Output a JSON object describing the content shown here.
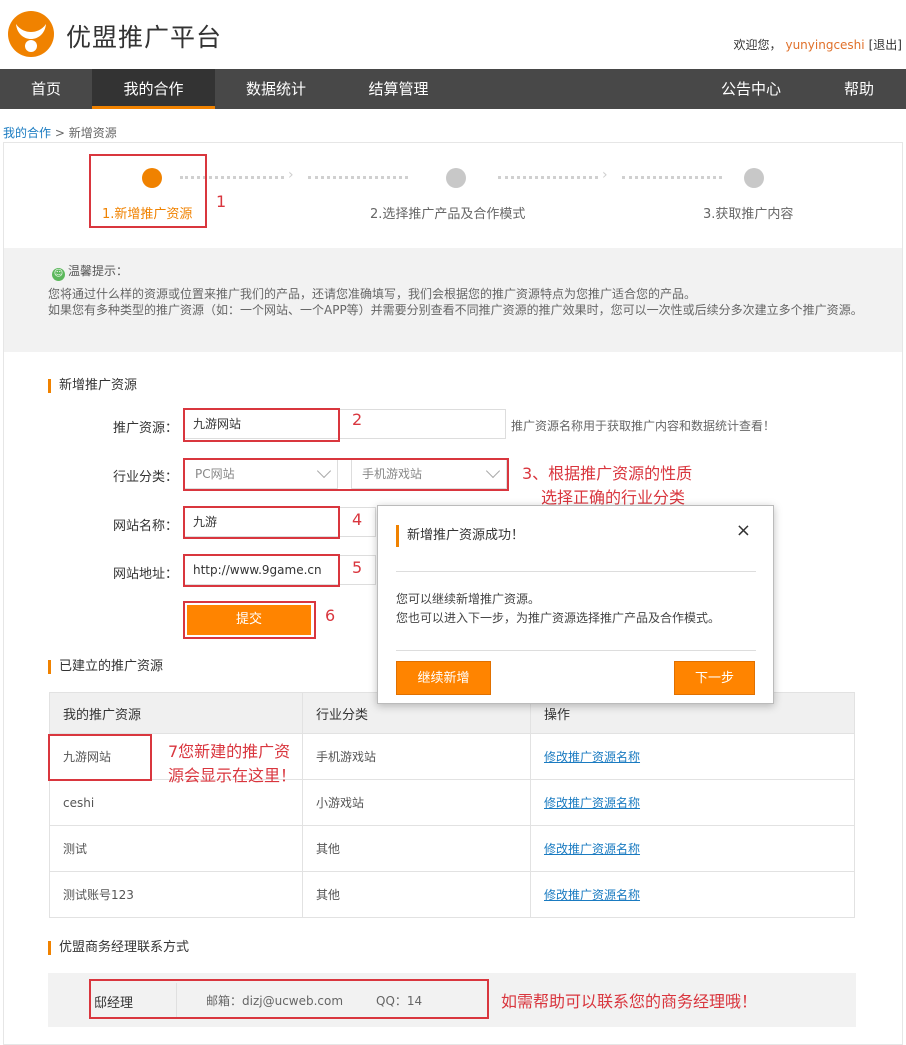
{
  "header": {
    "logo_text": "优盟推广平台",
    "welcome": "欢迎您，",
    "username": "yunyingceshi",
    "logout": "[退出]"
  },
  "nav": {
    "items": [
      {
        "label": "首页"
      },
      {
        "label": "我的合作"
      },
      {
        "label": "数据统计"
      },
      {
        "label": "结算管理"
      },
      {
        "label": "公告中心"
      },
      {
        "label": "帮助"
      }
    ],
    "active_index": 1
  },
  "breadcrumb": {
    "parent": "我的合作",
    "sep": " > ",
    "current": "新增资源"
  },
  "steps": [
    {
      "label": "1.新增推广资源"
    },
    {
      "label": "2.选择推广产品及合作模式"
    },
    {
      "label": "3.获取推广内容"
    }
  ],
  "tips": {
    "title": "温馨提示：",
    "line1": "您将通过什么样的资源或位置来推广我们的产品，还请您准确填写，我们会根据您的推广资源特点为您推广适合您的产品。",
    "line2": "如果您有多种类型的推广资源（如：一个网站、一个APP等）并需要分别查看不同推广资源的推广效果时，您可以一次性或后续分多次建立多个推广资源。"
  },
  "form": {
    "section_title": "新增推广资源",
    "resource_label": "推广资源：",
    "resource_value": "九游网站",
    "resource_hint": "推广资源名称用于获取推广内容和数据统计查看！",
    "category_label": "行业分类：",
    "category_primary": "PC网站",
    "category_secondary": "手机游戏站",
    "site_name_label": "网站名称：",
    "site_name_value": "九游",
    "site_url_label": "网站地址：",
    "site_url_value": "http://www.9game.cn",
    "submit_label": "提交"
  },
  "annotations": {
    "a1": "1",
    "a2": "2",
    "a3_line1": "3、根据推广资源的性质",
    "a3_line2": "选择正确的行业分类",
    "a4": "4",
    "a5": "5",
    "a6": "6",
    "a7_line1": "7您新建的推广资",
    "a7_line2": "源会显示在这里！",
    "a8": "如需帮助可以联系您的商务经理哦！"
  },
  "resources": {
    "section_title": "已建立的推广资源",
    "columns": [
      "我的推广资源",
      "行业分类",
      "操作"
    ],
    "rows": [
      {
        "name": "九游网站",
        "category": "手机游戏站",
        "action": "修改推广资源名称"
      },
      {
        "name": "ceshi",
        "category": "小游戏站",
        "action": "修改推广资源名称"
      },
      {
        "name": "测试",
        "category": "其他",
        "action": "修改推广资源名称"
      },
      {
        "name": "测试账号123",
        "category": "其他",
        "action": "修改推广资源名称"
      }
    ]
  },
  "contact": {
    "section_title": "优盟商务经理联系方式",
    "manager": "邸经理",
    "email": "邮箱：dizj@ucweb.com",
    "qq": "QQ：14"
  },
  "modal": {
    "title": "新增推广资源成功！",
    "close": "×",
    "line1": "您可以继续新增推广资源。",
    "line2": "您也可以进入下一步，为推广资源选择推广产品及合作模式。",
    "continue_label": "继续新增",
    "next_label": "下一步"
  },
  "colors": {
    "accent": "#f08200",
    "nav_bg": "#484848",
    "annotation": "#d9363e",
    "link": "#1a7bc1"
  }
}
